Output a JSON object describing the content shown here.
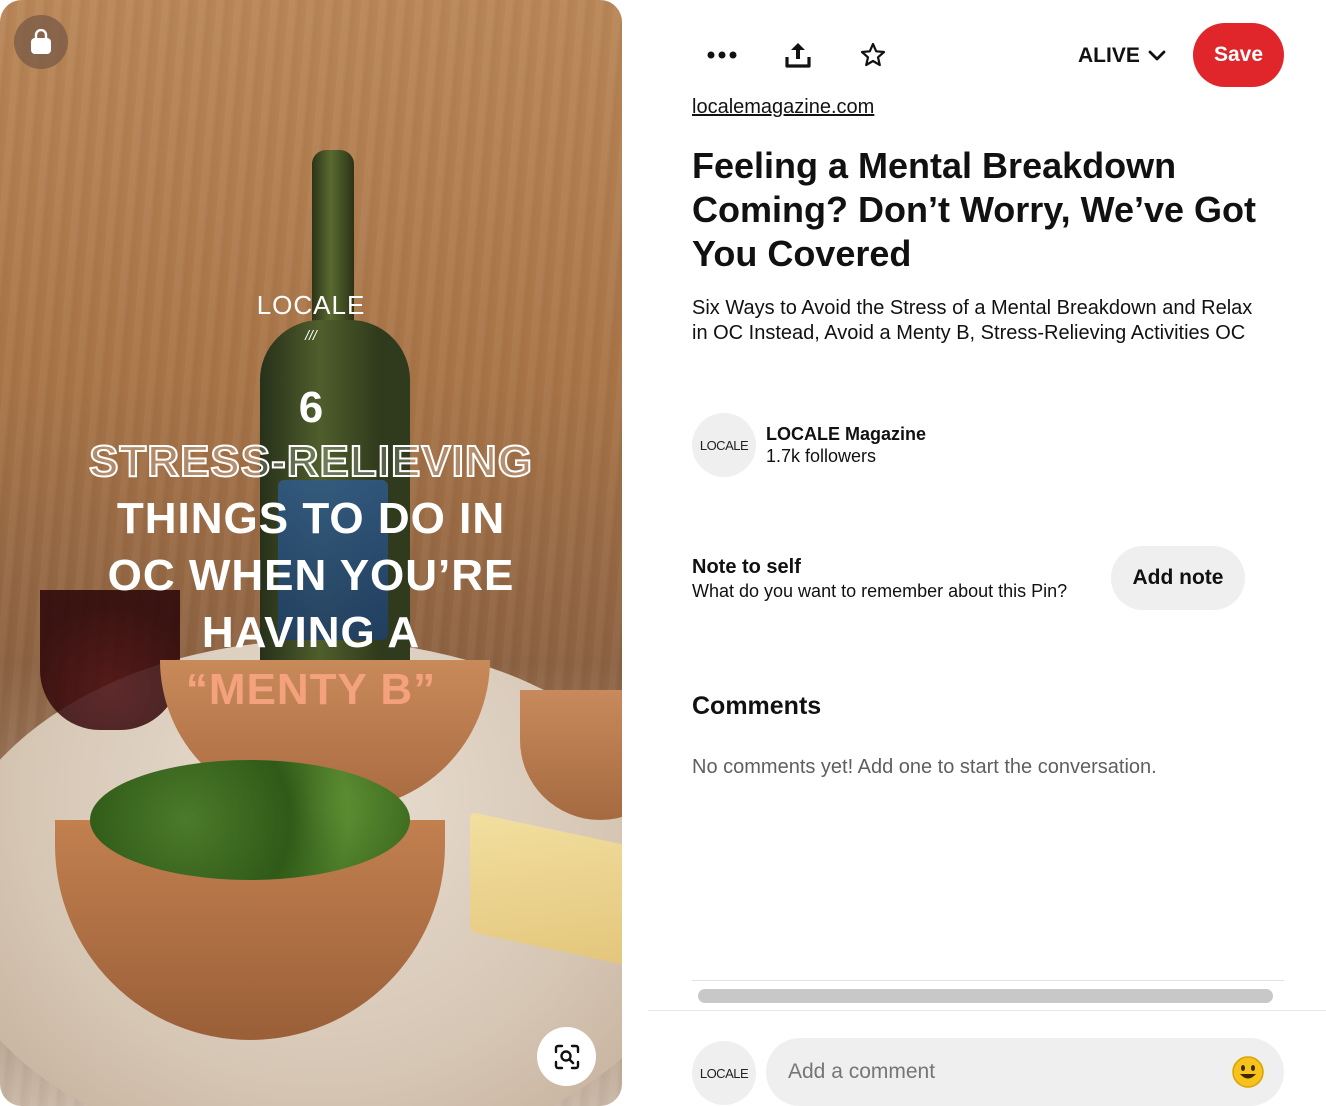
{
  "image": {
    "brand": "LOCALE",
    "brand_mark": "///",
    "headline_number": "6",
    "headline_lines": [
      "STRESS-RELIEVING",
      "THINGS TO DO IN",
      "OC WHEN YOU’RE",
      "HAVING A",
      "“MENTY B”"
    ]
  },
  "toolbar": {
    "board_name": "ALIVE",
    "save_label": "Save"
  },
  "pin": {
    "source": "localemagazine.com",
    "title": "Feeling a Mental Breakdown Coming? Don’t Worry, We’ve Got You Covered",
    "description": "Six Ways to Avoid the Stress of a Mental Breakdown and Relax in OC Instead, Avoid a Menty B, Stress-Relieving Activities OC"
  },
  "creator": {
    "avatar_text": "LOCALE",
    "name": "LOCALE Magazine",
    "followers": "1.7k followers"
  },
  "note": {
    "title": "Note to self",
    "prompt": "What do you want to remember about this Pin?",
    "button_label": "Add note"
  },
  "comments": {
    "heading": "Comments",
    "empty_text": "No comments yet! Add one to start the conversation.",
    "input_placeholder": "Add a comment",
    "avatar_text": "LOCALE"
  },
  "colors": {
    "save_red": "#e0252b",
    "accent_salmon": "#f4a27e"
  },
  "icons": {
    "shop": "shopping-bag-icon",
    "lens": "visual-search-icon",
    "more": "more-options-icon",
    "share": "share-icon",
    "favorite": "star-icon",
    "dropdown": "chevron-down-icon",
    "emoji": "smiley-emoji-icon"
  }
}
